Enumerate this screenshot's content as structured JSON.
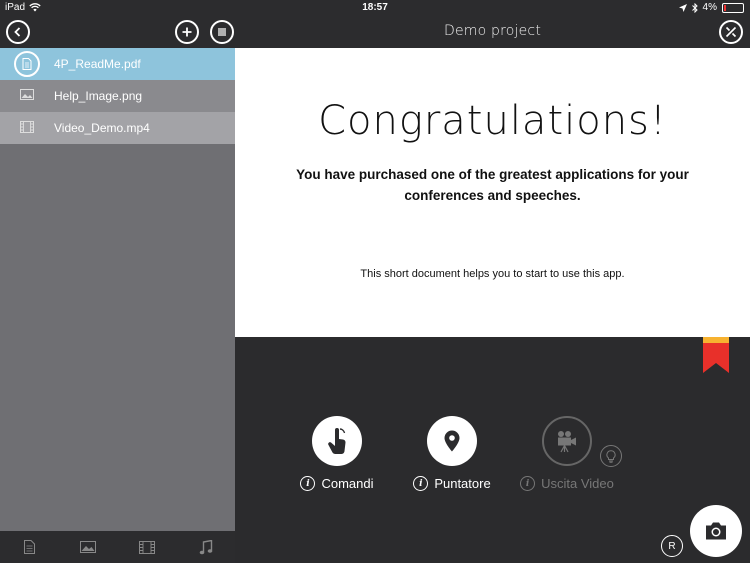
{
  "status_bar": {
    "device": "iPad",
    "time": "18:57",
    "battery": "4%"
  },
  "nav": {
    "title": "Demo project"
  },
  "files": [
    {
      "name": "4P_ReadMe.pdf",
      "icon": "document-icon"
    },
    {
      "name": "Help_Image.png",
      "icon": "image-icon"
    },
    {
      "name": "Video_Demo.mp4",
      "icon": "film-icon"
    }
  ],
  "document": {
    "headline": "Congratulations!",
    "subtitle": "You have purchased one of the greatest applications for your conferences and speeches.",
    "body": "This short document helps you to start to use this app."
  },
  "controls": {
    "commands_label": "Comandi",
    "pointer_label": "Puntatore",
    "video_output_label": "Uscita Video",
    "r_label": "R",
    "info_glyph": "i"
  },
  "colors": {
    "accent_blue": "#8ec4dc",
    "bookmark_red": "#e8302a",
    "bookmark_orange": "#f7b230"
  }
}
